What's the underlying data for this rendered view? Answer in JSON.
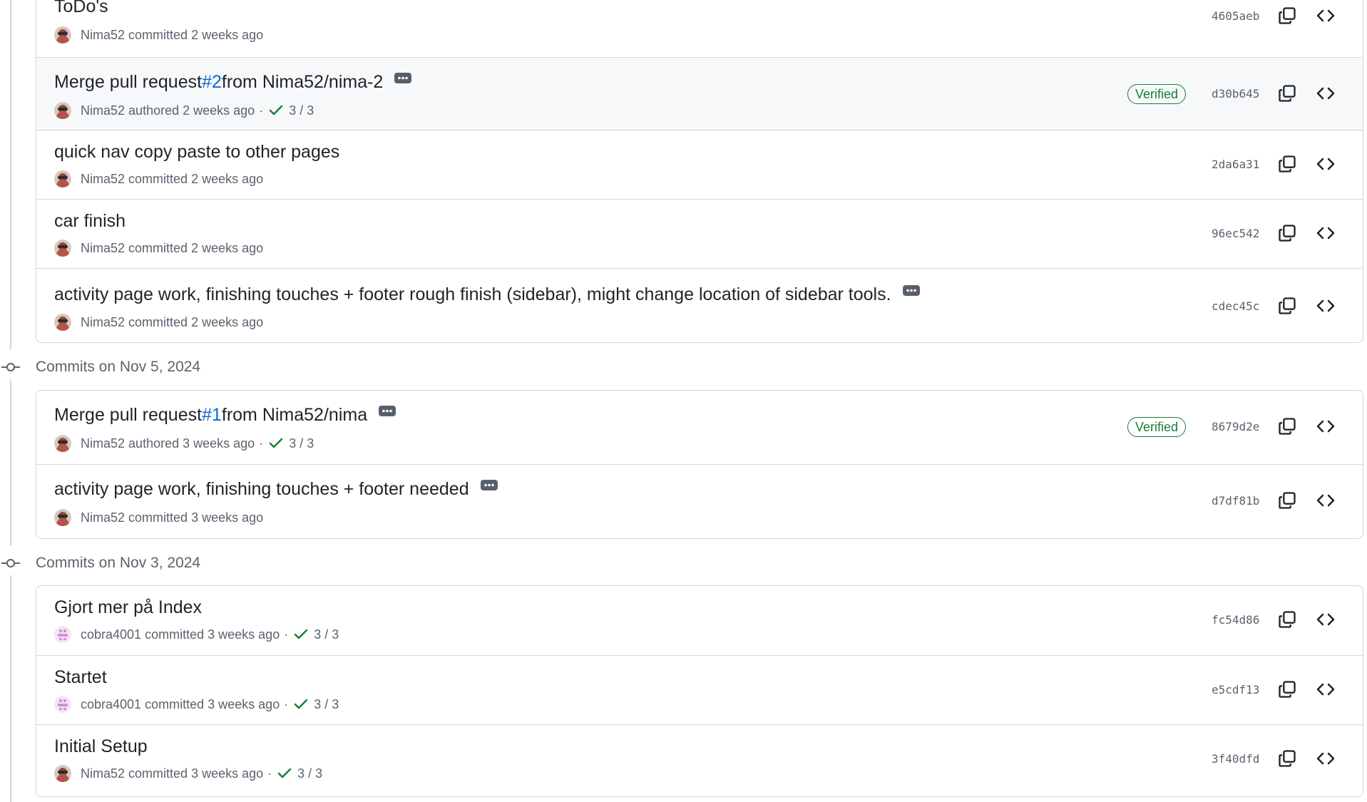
{
  "groups": [
    {
      "header": "",
      "commits": [
        {
          "title": "ToDo's",
          "author": "Nima52",
          "verb": "committed",
          "time": "2 weeks ago",
          "sha": "4605aeb",
          "avatar": "nima"
        },
        {
          "title_prefix": "Merge pull request ",
          "pr": "#2",
          "title_suffix": " from Nima52/nima-2",
          "has_ellipsis": true,
          "author": "Nima52",
          "verb": "authored",
          "time": "2 weeks ago",
          "checks": "3 / 3",
          "verified": "Verified",
          "sha": "d30b645",
          "avatar": "nima"
        },
        {
          "title": "quick nav copy paste to other pages",
          "author": "Nima52",
          "verb": "committed",
          "time": "2 weeks ago",
          "sha": "2da6a31",
          "avatar": "nima"
        },
        {
          "title": "car finish",
          "author": "Nima52",
          "verb": "committed",
          "time": "2 weeks ago",
          "sha": "96ec542",
          "avatar": "nima"
        },
        {
          "title": "activity page work, finishing touches + footer rough finish (sidebar), might change location of sidebar tools.",
          "has_ellipsis": true,
          "author": "Nima52",
          "verb": "committed",
          "time": "2 weeks ago",
          "sha": "cdec45c",
          "avatar": "nima"
        }
      ]
    },
    {
      "header": "Commits on Nov 5, 2024",
      "commits": [
        {
          "title_prefix": "Merge pull request ",
          "pr": "#1",
          "title_suffix": " from Nima52/nima",
          "has_ellipsis": true,
          "author": "Nima52",
          "verb": "authored",
          "time": "3 weeks ago",
          "checks": "3 / 3",
          "verified": "Verified",
          "sha": "8679d2e",
          "avatar": "nima"
        },
        {
          "title": "activity page work, finishing touches + footer needed",
          "has_ellipsis": true,
          "author": "Nima52",
          "verb": "committed",
          "time": "3 weeks ago",
          "sha": "d7df81b",
          "avatar": "nima"
        }
      ]
    },
    {
      "header": "Commits on Nov 3, 2024",
      "commits": [
        {
          "title": "Gjort mer på Index",
          "author": "cobra4001",
          "verb": "committed",
          "time": "3 weeks ago",
          "checks": "3 / 3",
          "sha": "fc54d86",
          "avatar": "cobra"
        },
        {
          "title": "Startet",
          "author": "cobra4001",
          "verb": "committed",
          "time": "3 weeks ago",
          "checks": "3 / 3",
          "sha": "e5cdf13",
          "avatar": "cobra"
        },
        {
          "title": "Initial Setup",
          "author": "Nima52",
          "verb": "committed",
          "time": "3 weeks ago",
          "checks": "3 / 3",
          "sha": "3f40dfd",
          "avatar": "nima"
        }
      ]
    }
  ],
  "icons": {
    "commit_node": "git-commit-icon",
    "copy": "copy-icon",
    "browse": "code-icon",
    "check": "check-icon",
    "ellipsis": "kebab-horizontal-icon"
  },
  "colors": {
    "verified": "#1a7f37",
    "link": "#0969da",
    "muted": "#59636e",
    "border": "#d0d7de"
  }
}
